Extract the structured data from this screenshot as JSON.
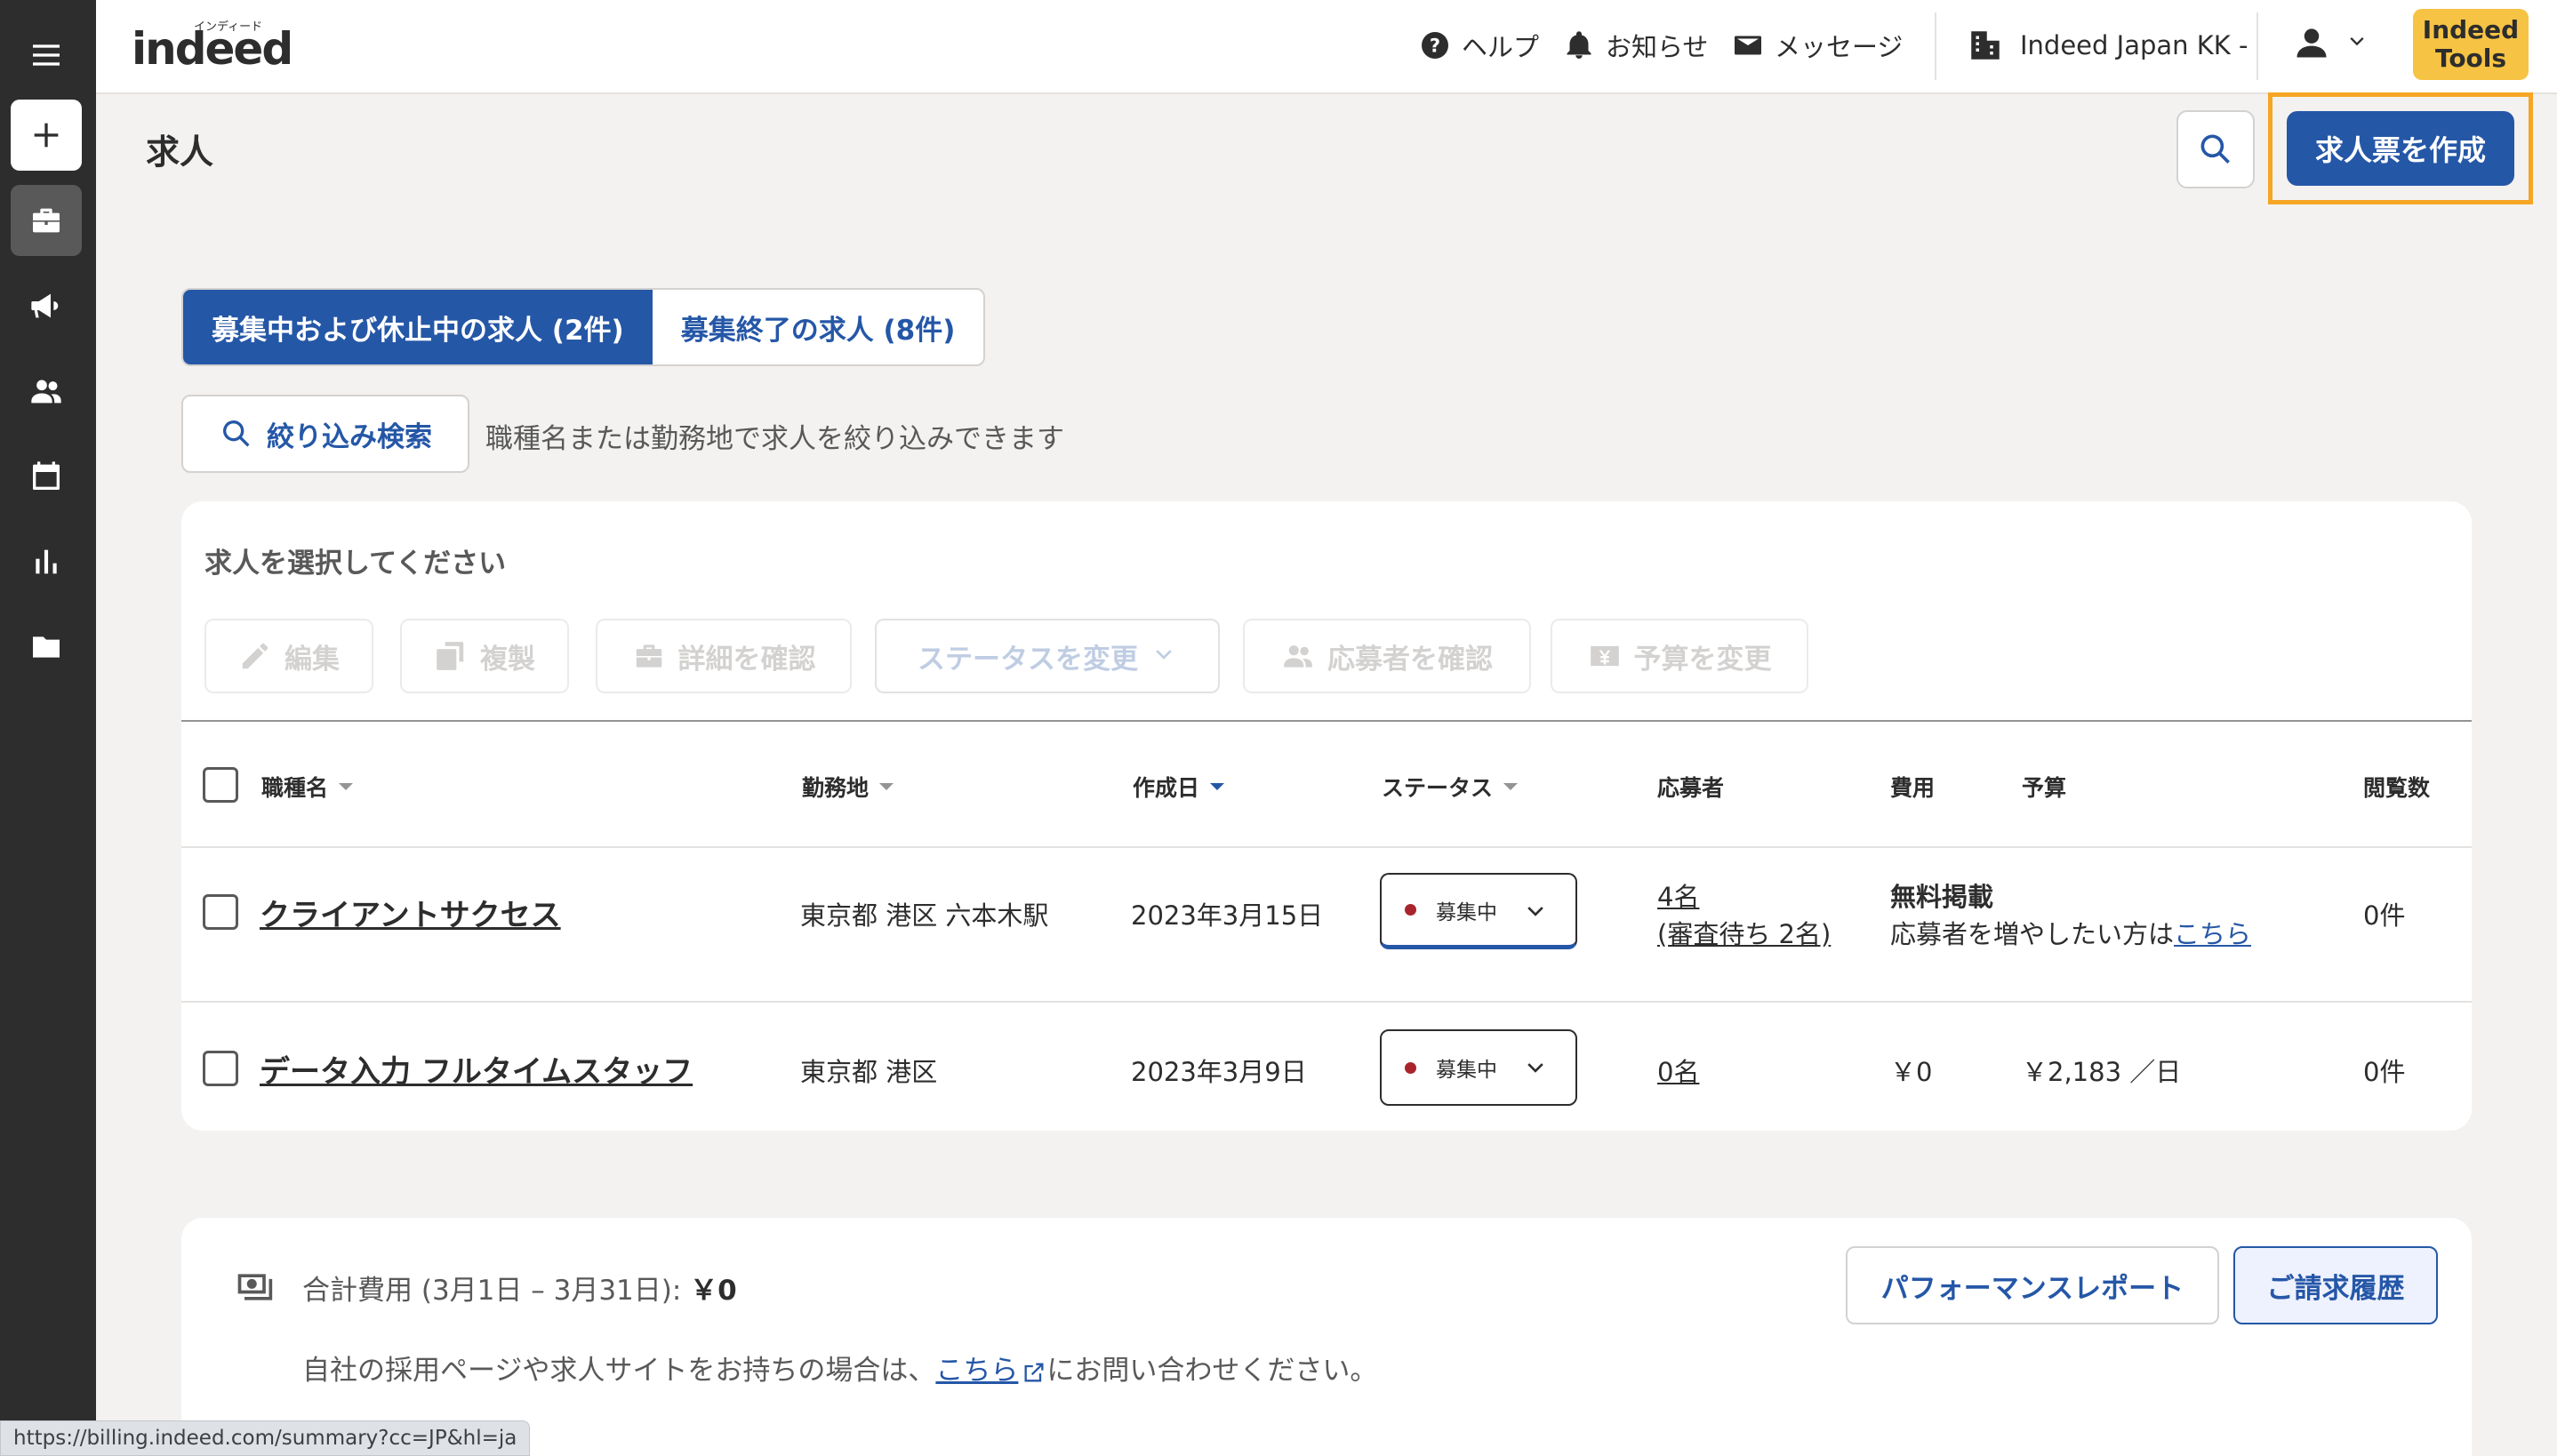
{
  "header": {
    "logo_small": "インディード",
    "logo_text": "indeed",
    "help": "ヘルプ",
    "notifications": "お知らせ",
    "messages": "メッセージ",
    "company": "Indeed Japan KK -",
    "tools_line1": "Indeed",
    "tools_line2": "Tools"
  },
  "page": {
    "title": "求人",
    "create_button": "求人票を作成"
  },
  "tabs": [
    {
      "label": "募集中および休止中の求人 (2件)",
      "active": true
    },
    {
      "label": "募集終了の求人 (8件)",
      "active": false
    }
  ],
  "filter": {
    "button": "絞り込み検索",
    "hint": "職種名または勤務地で求人を絞り込みできます"
  },
  "jobs_card": {
    "title": "求人を選択してください",
    "actions": {
      "edit": "編集",
      "copy": "複製",
      "details": "詳細を確認",
      "status": "ステータスを変更",
      "applicants": "応募者を確認",
      "budget": "予算を変更"
    },
    "columns": {
      "title": "職種名",
      "location": "勤務地",
      "created": "作成日",
      "status": "ステータス",
      "applicants": "応募者",
      "cost": "費用",
      "budget": "予算",
      "views": "閲覧数"
    },
    "rows": [
      {
        "title": "クライアントサクセス",
        "location": "東京都 港区 六本木駅",
        "created": "2023年3月15日",
        "status": "募集中",
        "applicants": "4名",
        "applicants_sub": "(審査待ち 2名)",
        "cost": "無料掲載",
        "cost_sub": "応募者を増やしたい方は",
        "cost_link": "こちら",
        "budget": "",
        "views": "0件"
      },
      {
        "title": "データ入力 フルタイムスタッフ",
        "location": "東京都 港区",
        "created": "2023年3月9日",
        "status": "募集中",
        "applicants": "0名",
        "cost": "￥0",
        "budget": "￥2,183 ／日",
        "views": "0件"
      }
    ]
  },
  "summary": {
    "total_label": "合計費用 (3月1日 – 3月31日): ",
    "total_value": "￥0",
    "contact_prefix": "自社の採用ページや求人サイトをお持ちの場合は、",
    "contact_link": "こちら",
    "contact_suffix": "にお問い合わせください。",
    "perf_button": "パフォーマンスレポート",
    "billing_button": "ご請求履歴"
  },
  "status_url": "https://billing.indeed.com/summary?cc=JP&hl=ja",
  "colors": {
    "primary": "#2557a7",
    "sidebar": "#2d2d2d",
    "highlight": "#f5a623",
    "tools": "#f6c344",
    "status_dot": "#a9252b"
  }
}
